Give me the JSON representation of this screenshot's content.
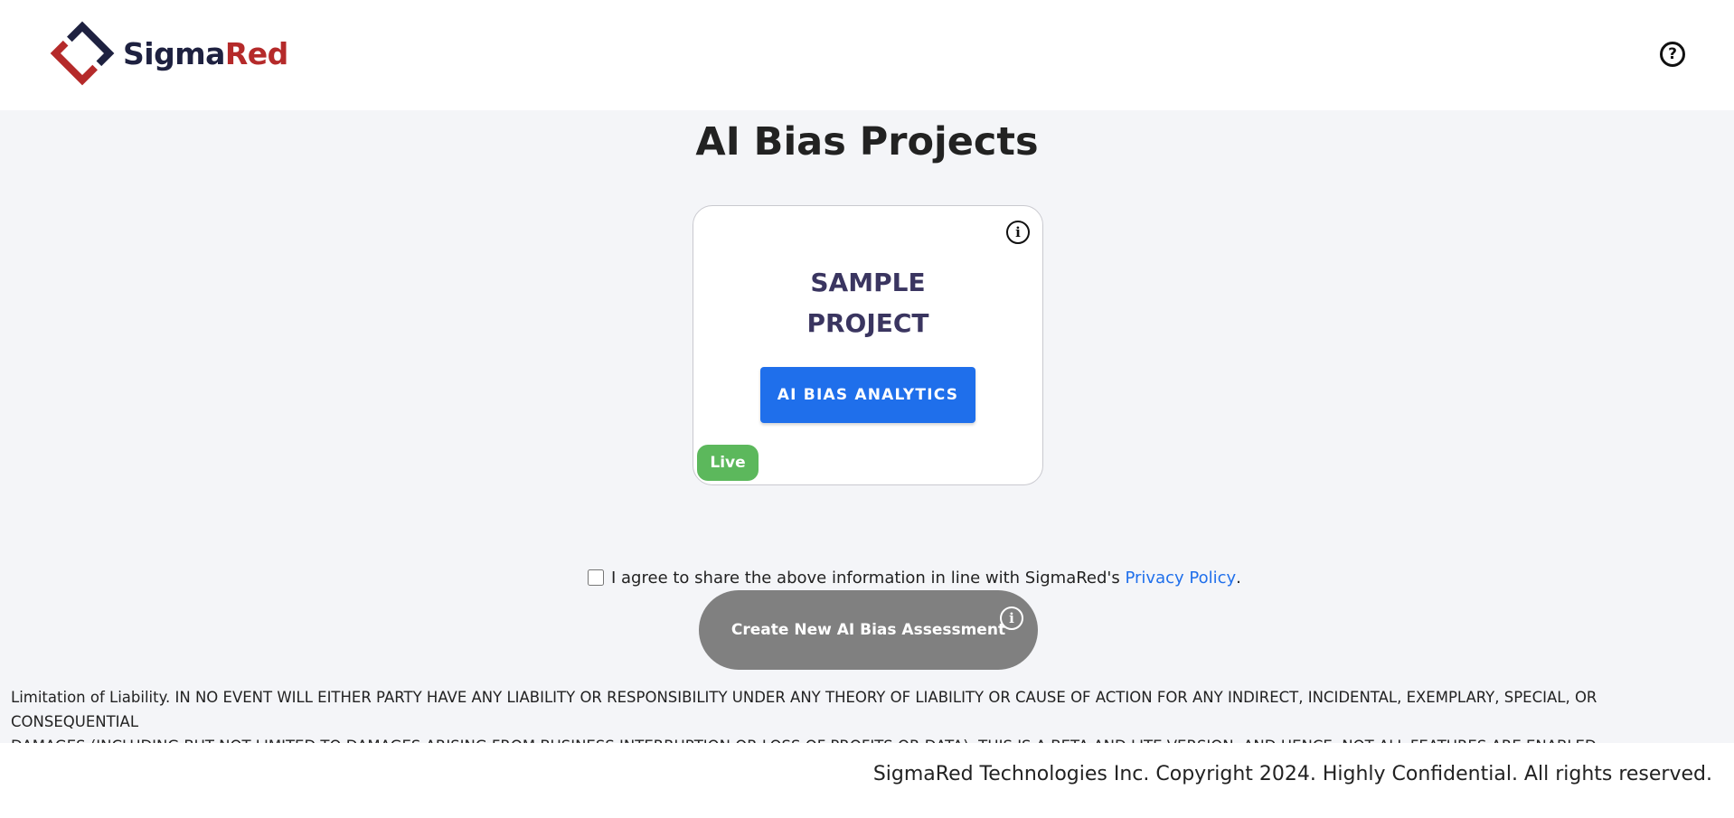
{
  "header": {
    "logo": {
      "text_primary": "Sigma",
      "text_accent": "Red",
      "colors": {
        "primary": "#1e2140",
        "accent": "#b52a2a"
      }
    },
    "help_icon": "help-circle-icon"
  },
  "main": {
    "title": "AI Bias Projects",
    "project_card": {
      "title": "SAMPLE\nPROJECT",
      "info_icon": "info-icon",
      "action_label": "AI BIAS ANALYTICS",
      "status": "Live",
      "status_color": "#5cb85c"
    },
    "consent": {
      "text": "I agree to share the above information in line with SigmaRed's ",
      "link_text": "Privacy Policy",
      "suffix": ".",
      "checked": false
    },
    "create_button": {
      "label": "Create New AI Bias Assessment",
      "info_icon": "info-icon"
    },
    "disclaimer": "Limitation of Liability. IN NO EVENT WILL EITHER PARTY HAVE ANY LIABILITY OR RESPONSIBILITY UNDER ANY THEORY OF LIABILITY OR CAUSE OF ACTION FOR ANY INDIRECT, INCIDENTAL, EXEMPLARY, SPECIAL, OR CONSEQUENTIAL\nDAMAGES (INCLUDING BUT NOT LIMITED TO DAMAGES ARISING FROM BUSINESS INTERRUPTION OR LOSS OF PROFITS OR DATA). THIS IS A BETA AND LITE VERSION, AND HENCE, NOT ALL FEATURES ARE ENABLED."
  },
  "footer": {
    "copyright": "SigmaRed Technologies Inc. Copyright 2024. Highly Confidential. All rights reserved."
  },
  "colors": {
    "accent_blue": "#1f6feb",
    "disabled_gray": "#808080",
    "page_bg": "#f4f5f8"
  }
}
